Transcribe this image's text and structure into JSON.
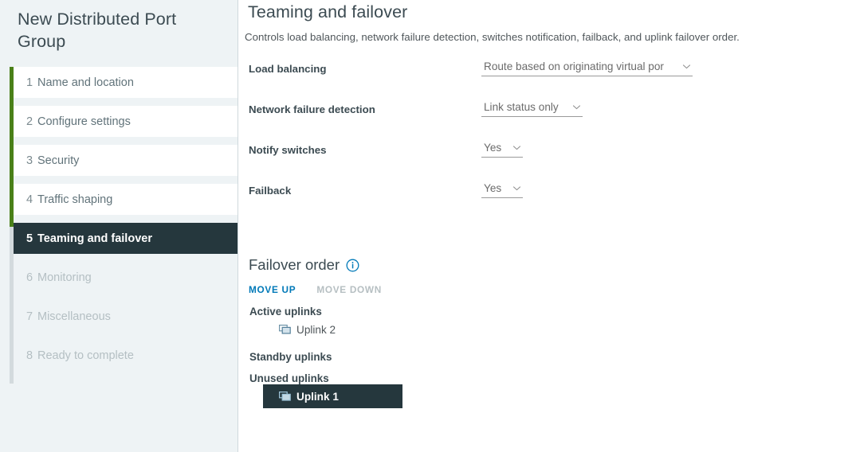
{
  "wizard": {
    "title": "New Distributed Port Group",
    "steps": [
      {
        "num": "1",
        "label": "Name and location",
        "state": "done"
      },
      {
        "num": "2",
        "label": "Configure settings",
        "state": "done"
      },
      {
        "num": "3",
        "label": "Security",
        "state": "done"
      },
      {
        "num": "4",
        "label": "Traffic shaping",
        "state": "done"
      },
      {
        "num": "5",
        "label": "Teaming and failover",
        "state": "selected"
      },
      {
        "num": "6",
        "label": "Monitoring",
        "state": "disabled"
      },
      {
        "num": "7",
        "label": "Miscellaneous",
        "state": "disabled"
      },
      {
        "num": "8",
        "label": "Ready to complete",
        "state": "disabled"
      }
    ],
    "rail_color_done": "#4a8019",
    "rail_color_todo": "#d3dadd",
    "selected_color": "#25373d"
  },
  "page": {
    "title": "Teaming and failover",
    "description": "Controls load balancing, network failure detection, switches notification, failback, and uplink failover order."
  },
  "form": {
    "rows": [
      {
        "label": "Load balancing",
        "value": "Route based on originating virtual por",
        "size": "wide"
      },
      {
        "label": "Network failure detection",
        "value": "Link status only",
        "size": "mid"
      },
      {
        "label": "Notify switches",
        "value": "Yes",
        "size": "narrow"
      },
      {
        "label": "Failback",
        "value": "Yes",
        "size": "narrow"
      }
    ]
  },
  "failover": {
    "title": "Failover order",
    "info_tooltip_icon": "info-circle-icon",
    "move_up_label": "MOVE UP",
    "move_down_label": "MOVE DOWN",
    "move_up_enabled": true,
    "move_down_enabled": false,
    "active_color": "#0079b8",
    "disabled_color": "#b6bfc2",
    "groups": [
      {
        "heading": "Active uplinks",
        "items": [
          {
            "name": "Uplink 2",
            "icon": "network-adapter-icon",
            "selected": false
          }
        ]
      },
      {
        "heading": "Standby uplinks",
        "items": []
      },
      {
        "heading": "Unused uplinks",
        "items": [
          {
            "name": "Uplink 1",
            "icon": "network-adapter-icon",
            "selected": true
          }
        ]
      }
    ]
  }
}
